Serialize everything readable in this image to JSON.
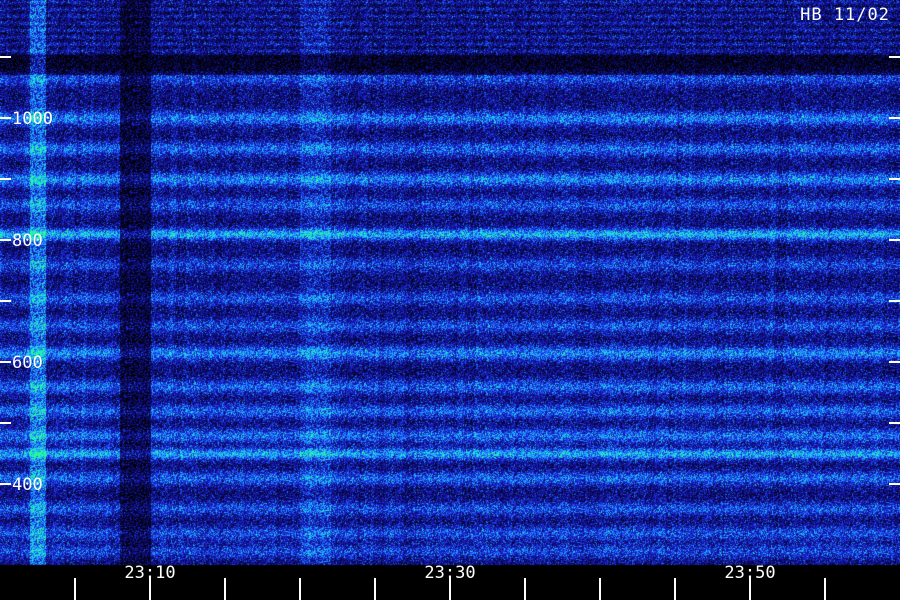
{
  "title": "HB 11/02",
  "chart_data": {
    "type": "heatmap",
    "title": "HB 11/02",
    "x_axis": {
      "unit": "time (HH:MM)",
      "range": [
        "23:02",
        "23:58"
      ],
      "ticks": [
        "23:05",
        "23:10",
        "23:15",
        "23:20",
        "23:25",
        "23:30",
        "23:35",
        "23:40",
        "23:45",
        "23:50",
        "23:55"
      ],
      "labels": [
        "23:10",
        "23:30",
        "23:50"
      ]
    },
    "y_axis": {
      "unit": "Hz",
      "range": [
        250,
        1200
      ],
      "ticks": [
        400,
        500,
        600,
        700,
        800,
        900,
        1000,
        1100
      ],
      "labels": [
        1000,
        800,
        600,
        400
      ]
    },
    "colormap": [
      "#000000",
      "#0a0a5a",
      "#1a1acc",
      "#1e78ff",
      "#1ed2ff",
      "#28ff8c"
    ],
    "bands": [
      {
        "freq": 1065,
        "level": 0.45
      },
      {
        "freq": 1000,
        "level": 0.7
      },
      {
        "freq": 950,
        "level": 0.6
      },
      {
        "freq": 900,
        "level": 0.75
      },
      {
        "freq": 858,
        "level": 0.5
      },
      {
        "freq": 810,
        "level": 1.0
      },
      {
        "freq": 760,
        "level": 0.45
      },
      {
        "freq": 705,
        "level": 0.5
      },
      {
        "freq": 660,
        "level": 0.5
      },
      {
        "freq": 615,
        "level": 0.75
      },
      {
        "freq": 560,
        "level": 0.6
      },
      {
        "freq": 520,
        "level": 0.6
      },
      {
        "freq": 480,
        "level": 0.65
      },
      {
        "freq": 450,
        "level": 0.95
      },
      {
        "freq": 410,
        "level": 0.6
      },
      {
        "freq": 360,
        "level": 0.5
      },
      {
        "freq": 320,
        "level": 0.5
      },
      {
        "freq": 290,
        "level": 0.45
      }
    ],
    "noise_bursts": [
      {
        "start": "23:02",
        "end": "23:03",
        "level": 0.9
      },
      {
        "start": "23:20",
        "end": "23:22",
        "level": 0.35
      }
    ],
    "dropout": {
      "start": "23:08",
      "end": "23:10"
    }
  }
}
